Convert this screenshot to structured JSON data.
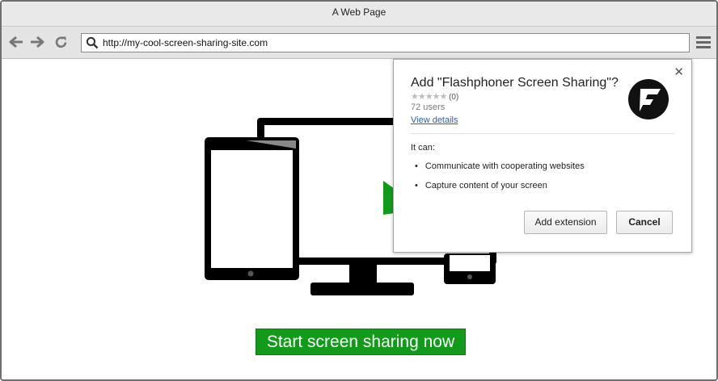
{
  "browser": {
    "title": "A Web Page",
    "url": "http://my-cool-screen-sharing-site.com"
  },
  "page": {
    "cta_label": "Start screen sharing now"
  },
  "popup": {
    "title": "Add \"Flashphoner Screen Sharing\"?",
    "stars": "★★★★★",
    "rating_count": "(0)",
    "users": "72 users",
    "view_details": "View details",
    "it_can": "It can:",
    "permissions": [
      "Communicate with cooperating websites",
      "Capture content of your screen"
    ],
    "add_label": "Add extension",
    "cancel_label": "Cancel",
    "close_glyph": "✕"
  },
  "colors": {
    "cta_green": "#129b1b",
    "link_blue": "#2f5fa8"
  }
}
